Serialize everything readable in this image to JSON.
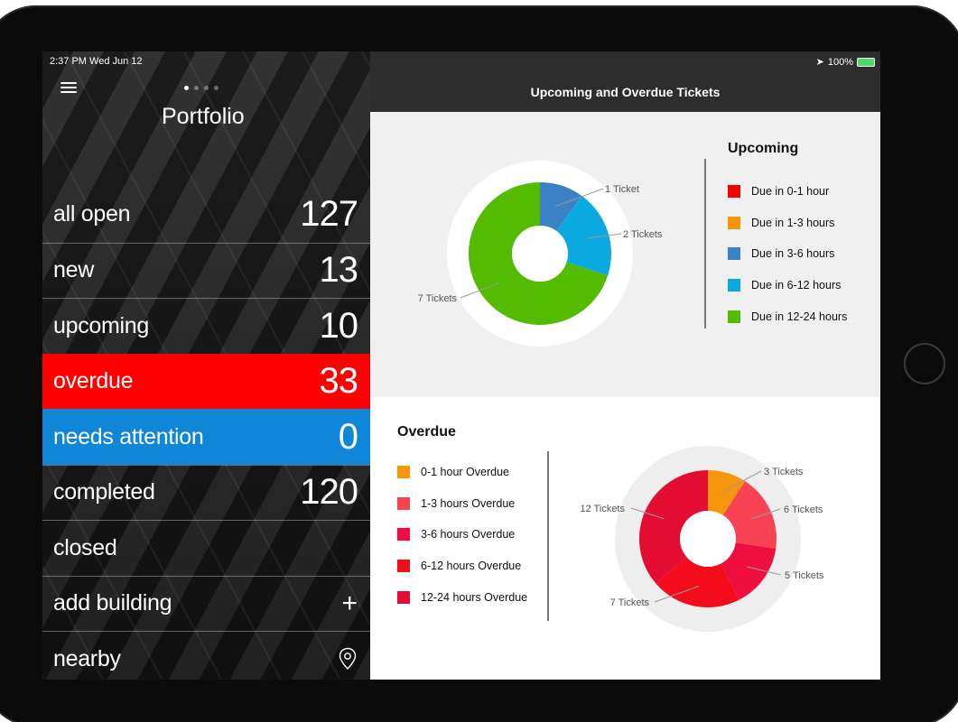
{
  "status": {
    "time": "2:37 PM  Wed Jun 12",
    "battery": "100%"
  },
  "left": {
    "title": "Portfolio",
    "items": [
      {
        "label": "all open",
        "count": "127"
      },
      {
        "label": "new",
        "count": "13"
      },
      {
        "label": "upcoming",
        "count": "10"
      },
      {
        "label": "overdue",
        "count": "33"
      },
      {
        "label": "needs attention",
        "count": "0"
      },
      {
        "label": "completed",
        "count": "120"
      },
      {
        "label": "closed",
        "count": ""
      },
      {
        "label": "add building",
        "icon": "plus-icon"
      },
      {
        "label": "nearby",
        "icon": "location-pin-icon"
      }
    ],
    "colors": {
      "overdue": "#fe0000",
      "needs_attention": "#1086d9"
    }
  },
  "right": {
    "title": "Upcoming and Overdue Tickets"
  },
  "chart_data": [
    {
      "type": "pie",
      "title": "Upcoming",
      "categories": [
        "Due in 0-1 hour",
        "Due in 1-3 hours",
        "Due in 3-6 hours",
        "Due in 6-12 hours",
        "Due in 12-24 hours"
      ],
      "values": [
        0,
        0,
        1,
        2,
        7
      ],
      "colors": [
        "#f60000",
        "#f89406",
        "#3b82c4",
        "#0aa9e0",
        "#54bb00"
      ],
      "data_labels": [
        "",
        "",
        "1 Ticket",
        "2 Tickets",
        "7 Tickets"
      ],
      "legend": "right"
    },
    {
      "type": "pie",
      "title": "Overdue",
      "categories": [
        "0-1 hour Overdue",
        "1-3 hours Overdue",
        "3-6 hours Overdue",
        "6-12 hours Overdue",
        "12-24 hours Overdue"
      ],
      "values": [
        3,
        6,
        5,
        7,
        12
      ],
      "colors": [
        "#f7950b",
        "#f94355",
        "#ef0f3e",
        "#f40b1c",
        "#e30c32"
      ],
      "data_labels": [
        "3 Tickets",
        "6 Tickets",
        "5 Tickets",
        "7 Tickets",
        "12 Tickets"
      ],
      "legend": "left"
    }
  ]
}
